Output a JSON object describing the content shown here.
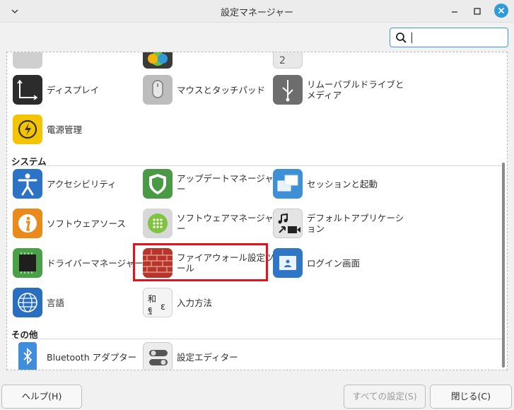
{
  "window": {
    "title": "設定マネージャー"
  },
  "search": {
    "value": "",
    "icon": "search-icon"
  },
  "sections": {
    "system": "システム",
    "other": "その他"
  },
  "top_partial": [
    "",
    "",
    "2"
  ],
  "hardware": {
    "display": "ディスプレイ",
    "mouse": "マウスとタッチパッド",
    "removable": "リムーバブルドライブとメディア",
    "power": "電源管理"
  },
  "system": {
    "accessibility": "アクセシビリティ",
    "update": "アップデートマネージャー",
    "session": "セッションと起動",
    "software_sources": "ソフトウェアソース",
    "software_manager": "ソフトウェアマネージャー",
    "default_apps": "デフォルトアプリケーション",
    "drivers": "ドライバーマネージャー",
    "firewall": "ファイアウォール設定ツール",
    "login": "ログイン画面",
    "language": "言語",
    "input": "入力方法"
  },
  "other": {
    "bluetooth": "Bluetooth アダプター",
    "settings_editor": "設定エディター"
  },
  "buttons": {
    "help": "ヘルプ(H)",
    "all_settings": "すべての設定(S)",
    "close": "閉じる(C)"
  },
  "colors": {
    "accent": "#2f9cd8",
    "highlight": "#e0141e"
  }
}
